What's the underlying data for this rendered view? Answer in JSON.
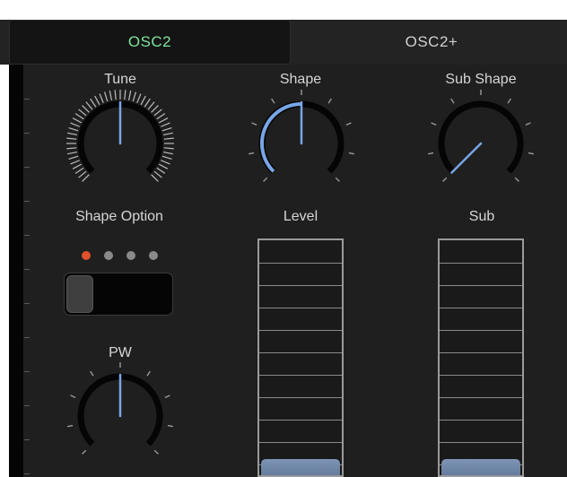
{
  "tabs": [
    {
      "label": "OSC2",
      "active": true,
      "color": "#7fe39d"
    },
    {
      "label": "OSC2+",
      "active": false
    }
  ],
  "knobs": {
    "tune": {
      "label": "Tune",
      "value": 0.5
    },
    "shape": {
      "label": "Shape",
      "value": 0.5
    },
    "sub_shape": {
      "label": "Sub Shape",
      "value": 0.0
    },
    "pw": {
      "label": "PW",
      "value": 0.5
    }
  },
  "shape_option": {
    "label": "Shape Option",
    "selected_index": 0,
    "count": 4
  },
  "faders": {
    "level": {
      "label": "Level",
      "value": 0.0
    },
    "sub": {
      "label": "Sub",
      "value": 0.0
    }
  },
  "colors": {
    "accent_blue": "#78a6e8",
    "active_tab_text": "#7fe39d",
    "selected_dot": "#e0512b"
  }
}
